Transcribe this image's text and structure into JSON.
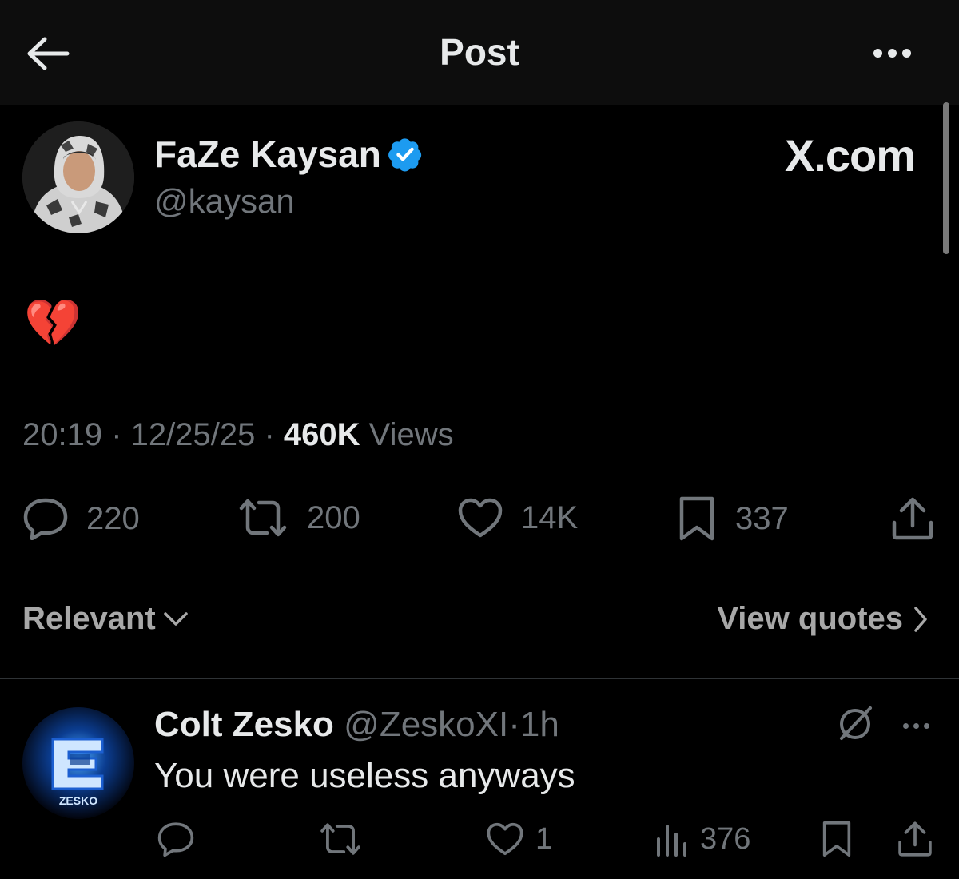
{
  "header": {
    "title": "Post"
  },
  "post": {
    "author_name": "FaZe Kaysan",
    "author_handle": "@kaysan",
    "watermark": "X.com",
    "text": "💔",
    "time": "20:19",
    "date": "12/25/25",
    "views_count": "460K",
    "views_label": "Views",
    "stats": {
      "replies": "220",
      "reposts": "200",
      "likes": "14K",
      "bookmarks": "337"
    }
  },
  "filters": {
    "sort_label": "Relevant",
    "quotes_label": "View quotes"
  },
  "reply": {
    "author_name": "Colt Zesko",
    "author_handle": "@ZeskoXI",
    "separator": "·",
    "time": "1h",
    "text": "You were useless anyways",
    "avatar_label": "ZESKO",
    "stats": {
      "likes": "1",
      "views": "376"
    }
  },
  "colors": {
    "background": "#000000",
    "text": "#e7e9ea",
    "muted": "#71767b",
    "verified": "#1d9bf0"
  },
  "icons": [
    "back-arrow-icon",
    "more-icon",
    "verified-badge-icon",
    "reply-icon",
    "repost-icon",
    "like-icon",
    "bookmark-icon",
    "share-icon",
    "chevron-down-icon",
    "chevron-right-icon",
    "grok-icon",
    "views-icon"
  ]
}
